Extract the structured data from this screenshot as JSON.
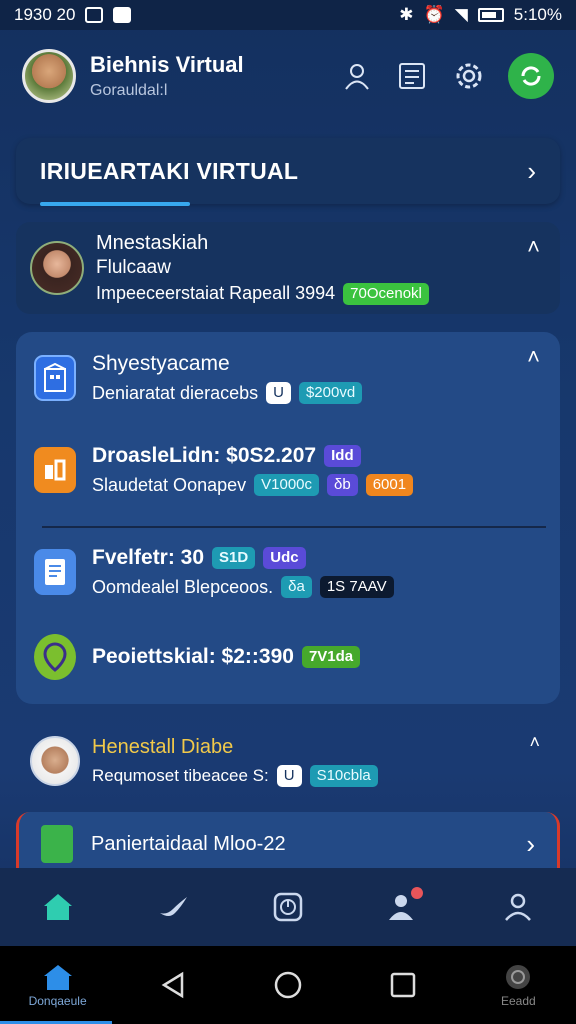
{
  "status_bar": {
    "time": "1930 20",
    "battery": "5:10%"
  },
  "header": {
    "title": "Biehnis Virtual",
    "subtitle": "Gorauldal:l"
  },
  "virtual_card": {
    "title": "IRIUEARTAKI VIRTUAL"
  },
  "profile_card": {
    "name": "Mnestaskiah",
    "subtitle": "Flulcaaw",
    "detail": "Impeeceerstaiat Rapeall 3994",
    "badge": "70Ocenokl"
  },
  "big_card": {
    "rows": [
      {
        "title": "Shyestyacame",
        "sub": "Deniaratat dieracebs",
        "badges": [
          "U",
          "$200vd"
        ]
      },
      {
        "title": "DroasleLidn: $0S2.207",
        "title_badge": "Idd",
        "sub": "Slaudetat Oonapev",
        "badges": [
          "V1000c",
          "δb",
          "6001"
        ]
      },
      {
        "title": "Fvelfetr: 30",
        "title_badges": [
          "S1D",
          "Udc"
        ],
        "sub": "Oomdealel Blepceoos.",
        "badges": [
          "δa",
          "1S 7AAV"
        ]
      },
      {
        "title": "Peoiettskial: $2::390",
        "title_badge": "7V1da"
      }
    ]
  },
  "doctor_card": {
    "name": "Henestall Diabe",
    "sub": "Requmoset tibeacee S:",
    "badges": [
      "U",
      "S10cbla"
    ]
  },
  "plan_card": {
    "title": "Paniertaidaal Mloo-22"
  },
  "navbar": {
    "home_label": "Donqaeule",
    "right_label": "Eeadd"
  }
}
